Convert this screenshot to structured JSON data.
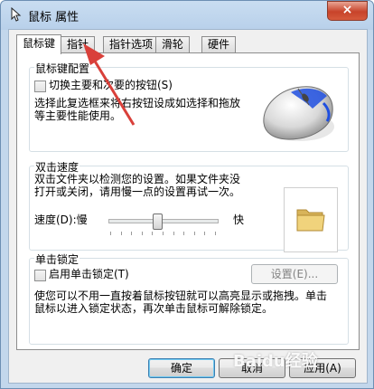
{
  "window": {
    "title": "鼠标 属性",
    "close_symbol": "×"
  },
  "tabs": [
    {
      "label": "鼠标键",
      "active": true
    },
    {
      "label": "指针",
      "active": false
    },
    {
      "label": "指针选项",
      "active": false
    },
    {
      "label": "滑轮",
      "active": false
    },
    {
      "label": "硬件",
      "active": false
    }
  ],
  "button_config": {
    "group_label": "鼠标键配置",
    "swap_checkbox_label": "切换主要和次要的按钮(S)",
    "description_line1": "选择此复选框来将右按钮设成如选择和拖放",
    "description_line2": "等主要性能使用。"
  },
  "double_click": {
    "group_label": "双击速度",
    "description_line1": "双击文件夹以检测您的设置。如果文件夹没",
    "description_line2": "打开或关闭，请用慢一点的设置再试一次。",
    "speed_label": "速度(D):慢",
    "fast_label": "快",
    "speed_level": 0.45
  },
  "click_lock": {
    "group_label": "单击锁定",
    "checkbox_label": "启用单击锁定(T)",
    "settings_button": "设置(E)...",
    "description_line1": "使您可以不用一直按着鼠标按钮就可以高亮显示或拖拽。单击",
    "description_line2": "鼠标以进入锁定状态，再次单击鼠标可解除锁定。"
  },
  "footer": {
    "ok": "确定",
    "cancel": "取消",
    "apply": "应用(A)"
  },
  "watermark": "Baidu经验",
  "colors": {
    "arrow": "#d9403a",
    "mouse_accent": "#1f4fe0",
    "folder": "#e8c76a"
  },
  "icons": [
    "mouse-pointer-icon",
    "mouse-illustration-icon",
    "folder-icon",
    "red-arrow-annotation"
  ]
}
